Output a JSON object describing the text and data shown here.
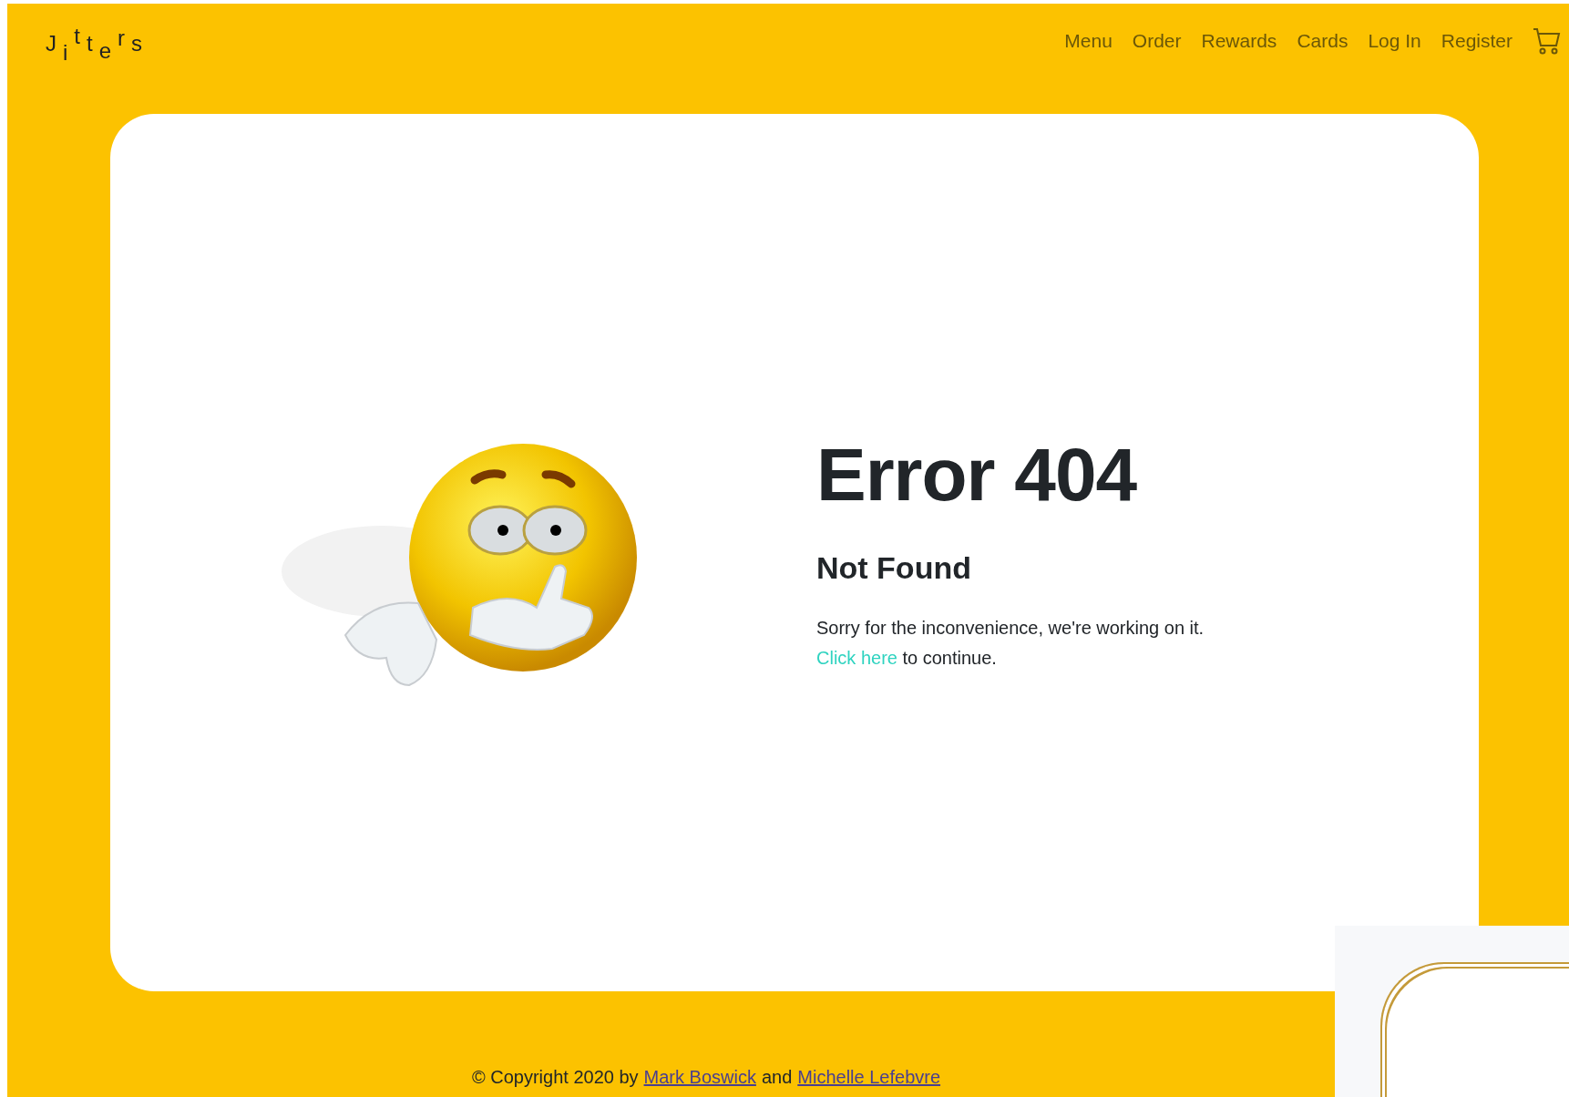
{
  "header": {
    "logo": "Jitters",
    "nav": [
      {
        "label": "Menu"
      },
      {
        "label": "Order"
      },
      {
        "label": "Rewards"
      },
      {
        "label": "Cards"
      },
      {
        "label": "Log In"
      },
      {
        "label": "Register"
      }
    ]
  },
  "error": {
    "title": "Error 404",
    "subtitle": "Not Found",
    "message": "Sorry for the inconvenience, we're working on it.",
    "link": "Click here",
    "link_suffix": "to continue."
  },
  "footer": {
    "prefix": "© Copyright 2020 by",
    "author_1": "Mark Boswick",
    "joiner": "and",
    "author_2": "Michelle Lefebvre"
  }
}
